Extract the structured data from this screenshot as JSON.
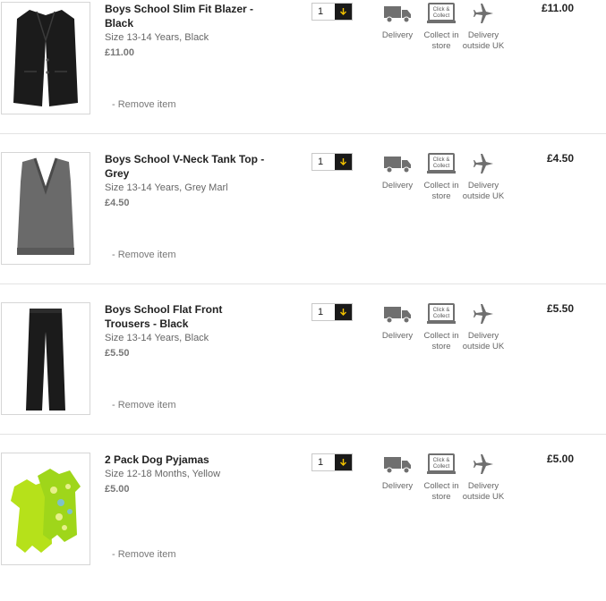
{
  "items": [
    {
      "name": "Boys School Slim Fit Blazer - Black",
      "variant": "Size 13-14 Years, Black",
      "unit_price": "£11.00",
      "quantity": "1",
      "line_price": "£11.00",
      "remove_label": "- Remove item",
      "image": "black-blazer"
    },
    {
      "name": "Boys School V-Neck Tank Top - Grey",
      "variant": "Size 13-14 Years, Grey Marl",
      "unit_price": "£4.50",
      "quantity": "1",
      "line_price": "£4.50",
      "remove_label": "- Remove item",
      "image": "grey-tank-top"
    },
    {
      "name": "Boys School Flat Front Trousers - Black",
      "variant": "Size 13-14 Years, Black",
      "unit_price": "£5.50",
      "quantity": "1",
      "line_price": "£5.50",
      "remove_label": "- Remove item",
      "image": "black-trousers"
    },
    {
      "name": "2 Pack Dog Pyjamas",
      "variant": "Size 12-18 Months, Yellow",
      "unit_price": "£5.00",
      "quantity": "1",
      "line_price": "£5.00",
      "remove_label": "- Remove item",
      "image": "yellow-pyjamas"
    }
  ],
  "fulfilment": {
    "delivery_label": "Delivery",
    "collect_label_1": "Collect in",
    "collect_label_2": "store",
    "collect_icon_text_1": "Click &",
    "collect_icon_text_2": "Collect",
    "outside_label_1": "Delivery",
    "outside_label_2": "outside UK"
  },
  "icons": {
    "qty_button": "arrow-down-icon",
    "delivery": "truck-icon",
    "collect": "click-collect-icon",
    "outside": "plane-icon"
  },
  "colors": {
    "accent": "#f2c200",
    "icon_grey": "#6f6f6f",
    "separator": "#e3e3e3"
  }
}
